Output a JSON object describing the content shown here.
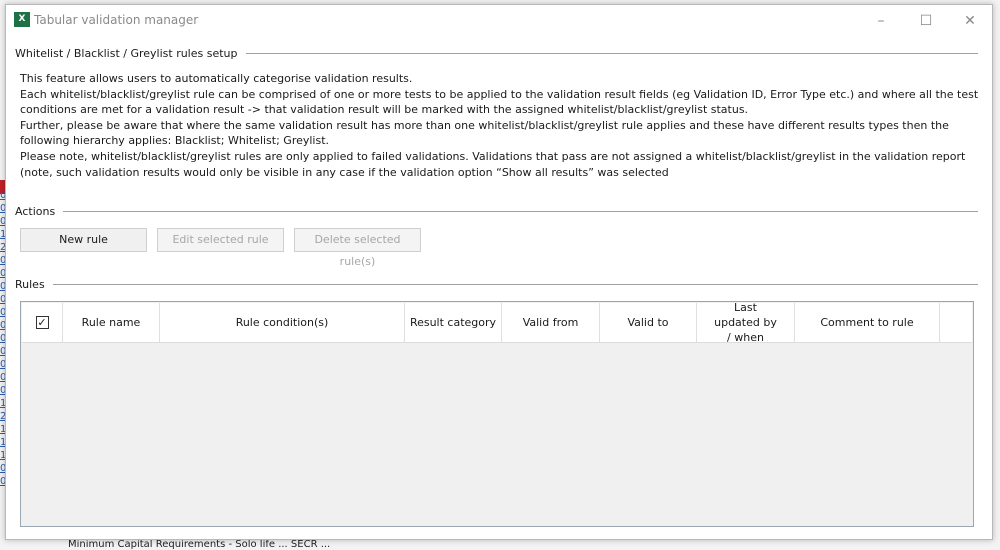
{
  "window": {
    "title": "Tabular validation manager",
    "app_icon": "excel-icon"
  },
  "sections": {
    "setup": "Whitelist / Blacklist / Greylist rules setup",
    "actions": "Actions",
    "rules": "Rules"
  },
  "description": [
    "This feature allows users to automatically categorise validation results.",
    "Each whitelist/blacklist/greylist rule can be comprised of one or more tests to be applied to the validation result fields (eg Validation ID, Error Type etc.) and where all the test conditions are met for a validation result -> that validation result will be marked with the assigned whitelist/blacklist/greylist status.",
    "Further, please be aware that where the same validation result has more than one whitelist/blacklist/greylist rule applies and these have different results types then the following hierarchy applies: Blacklist; Whitelist; Greylist.",
    "Please note, whitelist/blacklist/greylist rules are only applied to failed validations. Validations that pass are not assigned a whitelist/blacklist/greylist in the validation report (note, such validation results would only be visible in any case if the validation option “Show all results” was selected"
  ],
  "buttons": {
    "new": "New rule",
    "edit": "Edit selected rule",
    "delete": "Delete selected rule(s)"
  },
  "table": {
    "select_all_checked": true,
    "check_mark": "✓",
    "columns": [
      "Rule name",
      "Rule condition(s)",
      "Result category",
      "Valid from",
      "Valid to",
      "Last updated by / when",
      "Comment to rule"
    ],
    "rows": []
  },
  "background": {
    "bottom_text": "Minimum Capital Requirements - Solo life ... SECR ..."
  }
}
